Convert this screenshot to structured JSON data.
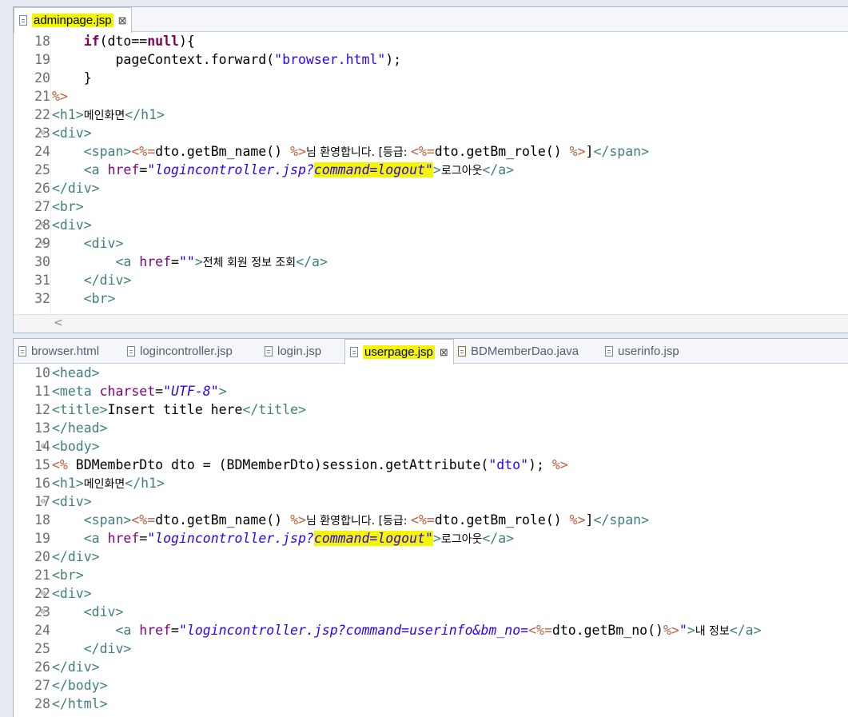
{
  "editor1": {
    "tab_label": "adminpage.jsp",
    "tab_close": "⊠",
    "lines": [
      {
        "n": "18",
        "fold": false
      },
      {
        "n": "19",
        "fold": false
      },
      {
        "n": "20",
        "fold": false
      },
      {
        "n": "21",
        "fold": false
      },
      {
        "n": "22",
        "fold": false
      },
      {
        "n": "23",
        "fold": true
      },
      {
        "n": "24",
        "fold": false
      },
      {
        "n": "25",
        "fold": false
      },
      {
        "n": "26",
        "fold": false
      },
      {
        "n": "27",
        "fold": false
      },
      {
        "n": "28",
        "fold": true
      },
      {
        "n": "29",
        "fold": true
      },
      {
        "n": "30",
        "fold": false
      },
      {
        "n": "31",
        "fold": false
      },
      {
        "n": "32",
        "fold": false
      }
    ],
    "scroll_left": "<"
  },
  "editor2": {
    "tabs": [
      {
        "label": "browser.html",
        "icon": "file-icon"
      },
      {
        "label": "logincontroller.jsp",
        "icon": "file-icon"
      },
      {
        "label": "login.jsp",
        "icon": "file-icon"
      },
      {
        "label": "userpage.jsp",
        "icon": "file-icon",
        "active": true
      },
      {
        "label": "BDMemberDao.java",
        "icon": "java-file-icon"
      },
      {
        "label": "userinfo.jsp",
        "icon": "file-icon"
      }
    ],
    "tab_close": "⊠",
    "lines": [
      {
        "n": "10"
      },
      {
        "n": "11"
      },
      {
        "n": "12"
      },
      {
        "n": "13"
      },
      {
        "n": "14"
      },
      {
        "n": "15"
      },
      {
        "n": "16"
      },
      {
        "n": "17"
      },
      {
        "n": "18"
      },
      {
        "n": "19"
      },
      {
        "n": "20"
      },
      {
        "n": "21"
      },
      {
        "n": "22"
      },
      {
        "n": "23"
      },
      {
        "n": "24"
      },
      {
        "n": "25"
      },
      {
        "n": "26"
      },
      {
        "n": "27"
      },
      {
        "n": "28"
      }
    ]
  },
  "code": {
    "e1_18_kw1": "if",
    "e1_18_a": "(dto==",
    "e1_18_kw2": "null",
    "e1_18_b": "){",
    "e1_19_a": "pageContext.forward(",
    "e1_19_s": "\"browser.html\"",
    "e1_19_b": ");",
    "e1_20": "}",
    "e1_21": "%>",
    "e1_22_t1": "<h1>",
    "e1_22_k": "메인화면",
    "e1_22_t2": "</h1>",
    "e1_23": "<div>",
    "e1_24_t1": "<span>",
    "e1_24_j1": "<%=",
    "e1_24_c1": "dto.getBm_name() ",
    "e1_24_j2": "%>",
    "e1_24_k": "님 환영합니다. [등급: ",
    "e1_24_j3": "<%=",
    "e1_24_c2": "dto.getBm_role() ",
    "e1_24_j4": "%>",
    "e1_24_c3": "]",
    "e1_24_t2": "</span>",
    "e1_25_t1": "<a ",
    "e1_25_at": "href",
    "e1_25_eq": "=",
    "e1_25_v1": "\"logincontroller.jsp?",
    "e1_25_v2": "command=logout\"",
    "e1_25_t2": ">",
    "e1_25_k": "로그아웃",
    "e1_25_t3": "</a>",
    "e1_26": "</div>",
    "e1_27": "<br>",
    "e1_28": "<div>",
    "e1_29": "<div>",
    "e1_30_t1": "<a ",
    "e1_30_at": "href",
    "e1_30_eq": "=",
    "e1_30_v": "\"\"",
    "e1_30_t2": ">",
    "e1_30_k": "전체 회원 정보 조회",
    "e1_30_t3": "</a>",
    "e1_31": "</div>",
    "e1_32": "<br>",
    "e2_10": "<head>",
    "e2_11_t1": "<meta ",
    "e2_11_at": "charset",
    "e2_11_eq": "=",
    "e2_11_v": "\"UTF-8\"",
    "e2_11_t2": ">",
    "e2_12_t1": "<title>",
    "e2_12_c": "Insert title here",
    "e2_12_t2": "</title>",
    "e2_13": "</head>",
    "e2_14": "<body>",
    "e2_15_j1": "<%",
    "e2_15_c": " BDMemberDto dto = (BDMemberDto)session.getAttribute(",
    "e2_15_s": "\"dto\"",
    "e2_15_c2": "); ",
    "e2_15_j2": "%>",
    "e2_16_t1": "<h1>",
    "e2_16_k": "메인화면",
    "e2_16_t2": "</h1>",
    "e2_17": "<div>",
    "e2_18_t1": "<span>",
    "e2_18_j1": "<%=",
    "e2_18_c1": "dto.getBm_name() ",
    "e2_18_j2": "%>",
    "e2_18_k": "님 환영합니다. [등급: ",
    "e2_18_j3": "<%=",
    "e2_18_c2": "dto.getBm_role() ",
    "e2_18_j4": "%>",
    "e2_18_c3": "]",
    "e2_18_t2": "</span>",
    "e2_19_t1": "<a ",
    "e2_19_at": "href",
    "e2_19_eq": "=",
    "e2_19_v1": "\"logincontroller.jsp?",
    "e2_19_v2": "command=logout\"",
    "e2_19_t2": ">",
    "e2_19_k": "로그아웃",
    "e2_19_t3": "</a>",
    "e2_20": "</div>",
    "e2_21": "<br>",
    "e2_22": "<div>",
    "e2_23": "<div>",
    "e2_24_t1": "<a ",
    "e2_24_at": "href",
    "e2_24_eq": "=",
    "e2_24_v1": "\"logincontroller.jsp?command=userinfo&bm_no=",
    "e2_24_j1": "<%=",
    "e2_24_c": "dto.getBm_no()",
    "e2_24_j2": "%>",
    "e2_24_v2": "\"",
    "e2_24_t2": ">",
    "e2_24_k": "내 정보",
    "e2_24_t3": "</a>",
    "e2_25": "</div>",
    "e2_26": "</div>",
    "e2_27": "</body>",
    "e2_28": "</html>"
  }
}
